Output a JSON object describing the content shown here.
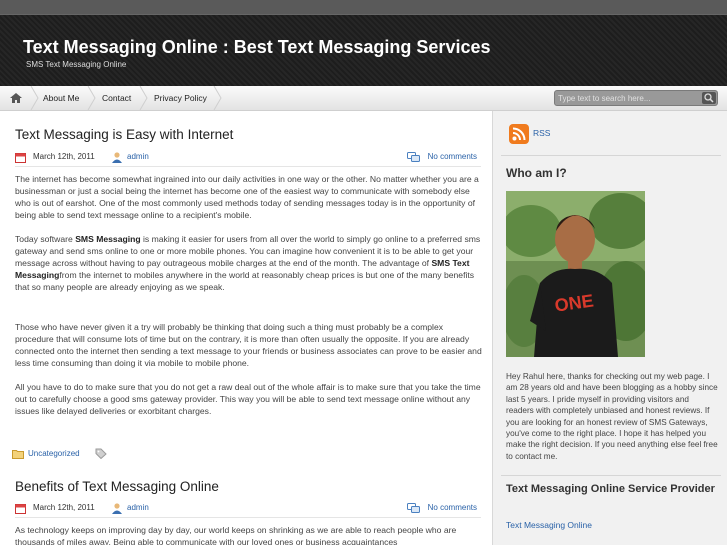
{
  "site": {
    "title": "Text Messaging Online : Best Text Messaging Services",
    "description": "SMS Text Messaging Online"
  },
  "nav": {
    "items": [
      {
        "label": "About Me"
      },
      {
        "label": "Contact"
      },
      {
        "label": "Privacy Policy"
      }
    ],
    "search_placeholder": "Type text to search here..."
  },
  "posts": [
    {
      "title": "Text Messaging is Easy with Internet",
      "date": "March 12th, 2011",
      "author": "admin",
      "comments": "No comments",
      "paragraphs": [
        {
          "parts": [
            "The internet has become somewhat ingrained into our daily activities in one way or the other. No matter whether you are a businessman or just a social being the internet has become one of the easiest way to communicate with somebody else who is out of earshot. One of the most commonly used methods today of sending messages today is in the opportunity of being able to send text message online to a recipient's mobile."
          ]
        },
        {
          "parts": [
            "Today software ",
            "SMS Messaging",
            " is making it easier for users from all over the world to simply go online to a preferred sms gateway and send sms online to one or more mobile phones. You can imagine how convenient it is to be able to get your message across without having to pay outrageous mobile charges at the end of the month. The advantage of ",
            "SMS Text Messaging",
            "from the internet to mobiles anywhere in the world at reasonably cheap prices is but one of the many benefits that so many people are already enjoying as we speak."
          ]
        },
        {
          "parts": [
            "Those who have never given it a try will probably be thinking that doing such a thing must probably be a complex procedure that will consume lots of time but on the contrary, it is more than often usually the opposite. If you are already connected onto the internet then sending a text message to your friends or business associates can prove to be easier and less time consuming than doing it via mobile to mobile phone."
          ]
        },
        {
          "parts": [
            "All you have to do to make sure that you do not get a raw deal out of the whole affair is to make sure that you take the time out to carefully choose a good sms gateway provider. This way you will be able to send text message online without any issues like delayed deliveries or exorbitant charges."
          ]
        }
      ],
      "category": "Uncategorized"
    },
    {
      "title": "Benefits of Text Messaging Online",
      "date": "March 12th, 2011",
      "author": "admin",
      "comments": "No comments",
      "paragraphs": [
        {
          "parts": [
            "As technology keeps on improving day by day, our world keeps on shrinking as we are able to reach people who are thousands of miles away. Being able to communicate with our loved ones or business acquaintances"
          ]
        }
      ]
    }
  ],
  "sidebar": {
    "rss_label": "RSS",
    "about_title": "Who am I?",
    "photo_text": "ONE",
    "about_text": "Hey Rahul here, thanks for checking out my web page. I am 28 years old and have been blogging as a hobby since last 5 years. I pride myself in providing visitors and readers with completely unbiased and honest reviews. If you are looking for an honest review of SMS Gateways, you've come to the right place. I hope it has helped you make the right decision. If you need anything else feel free to contact me.",
    "provider_title": "Text Messaging Online Service Provider",
    "provider_link": "Text Messaging Online"
  },
  "colors": {
    "link": "#2a62a8",
    "header_bg": "#222222",
    "rss": "#f07b1e"
  }
}
